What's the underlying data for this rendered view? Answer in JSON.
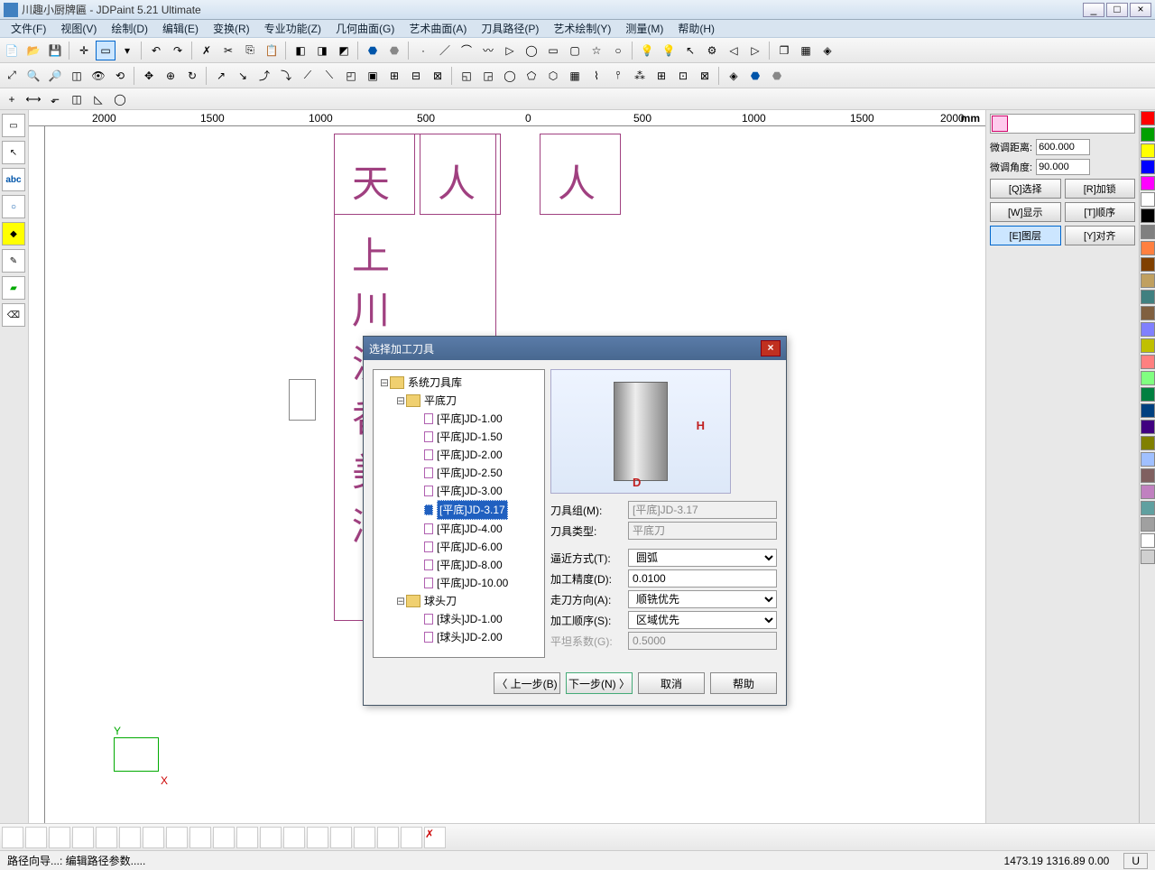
{
  "app": {
    "title": "川趣小厨牌匾 - JDPaint 5.21 Ultimate"
  },
  "menu": [
    "文件(F)",
    "视图(V)",
    "绘制(D)",
    "编辑(E)",
    "变换(R)",
    "专业功能(Z)",
    "几何曲面(G)",
    "艺术曲面(A)",
    "刀具路径(P)",
    "艺术绘制(Y)",
    "测量(M)",
    "帮助(H)"
  ],
  "ruler": {
    "unit": "mm",
    "marks": [
      "2000",
      "1500",
      "1000",
      "500",
      "0",
      "500",
      "1000",
      "1500",
      "2000"
    ]
  },
  "rightpanel": {
    "dist_label": "微调距离:",
    "dist_value": "600.000",
    "angle_label": "微调角度:",
    "angle_value": "90.000",
    "buttons": [
      "[Q]选择",
      "[R]加锁",
      "[W]显示",
      "[T]顺序",
      "[E]图层",
      "[Y]对齐"
    ],
    "active_button_index": 4
  },
  "colors": [
    "#ff0000",
    "#00a000",
    "#ffff00",
    "#0000ff",
    "#ff00ff",
    "#ffffff",
    "#000000",
    "#808080",
    "#ff8040",
    "#804000",
    "#c0a060",
    "#408080",
    "#806040",
    "#8080ff",
    "#c0c000",
    "#ff8080",
    "#80ff80",
    "#008040",
    "#004080",
    "#400080",
    "#808000",
    "#a0c0ff",
    "#806060",
    "#c080c0",
    "#60a0a0",
    "#a0a0a0",
    "#ffffff",
    "#d0d0d0"
  ],
  "dialog": {
    "title": "选择加工刀具",
    "tree": {
      "root": "系统刀具库",
      "group1": "平底刀",
      "group1_items": [
        "[平底]JD-1.00",
        "[平底]JD-1.50",
        "[平底]JD-2.00",
        "[平底]JD-2.50",
        "[平底]JD-3.00",
        "[平底]JD-3.17",
        "[平底]JD-4.00",
        "[平底]JD-6.00",
        "[平底]JD-8.00",
        "[平底]JD-10.00"
      ],
      "selected_index": 5,
      "group2": "球头刀",
      "group2_items": [
        "[球头]JD-1.00",
        "[球头]JD-2.00"
      ]
    },
    "preview": {
      "H": "H",
      "D": "D"
    },
    "params": {
      "tool_group_label": "刀具组(M):",
      "tool_group_value": "[平底]JD-3.17",
      "tool_type_label": "刀具类型:",
      "tool_type_value": "平底刀",
      "approach_label": "逼近方式(T):",
      "approach_value": "圆弧",
      "precision_label": "加工精度(D):",
      "precision_value": "0.0100",
      "direction_label": "走刀方向(A):",
      "direction_value": "顺铣优先",
      "order_label": "加工顺序(S):",
      "order_value": "区域优先",
      "flat_label": "平坦系数(G):",
      "flat_value": "0.5000"
    },
    "buttons": {
      "back": "〈 上一步(B)",
      "next": "下一步(N) 〉",
      "cancel": "取消",
      "help": "帮助"
    }
  },
  "status": {
    "left": "路径向导...: 编辑路径参数.....",
    "coords": "1473.19 1316.89 0.00",
    "mode": "U"
  },
  "canvas_chars": [
    "天",
    "人",
    "人",
    "上",
    "川",
    "流",
    "香",
    "美",
    "酒"
  ]
}
